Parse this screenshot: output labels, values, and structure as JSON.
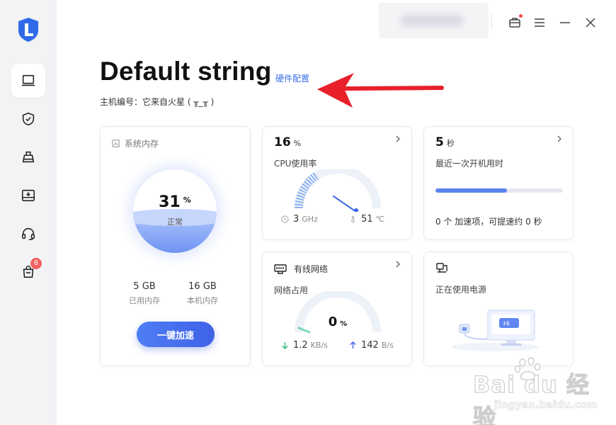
{
  "header": {
    "title": "Default string",
    "hardware_link": "硬件配置",
    "host_id": "主机编号：它来自火星 ( ╥_╥ )"
  },
  "sidebar": {
    "items": [
      {
        "icon": "computer-icon"
      },
      {
        "icon": "shield-check-icon"
      },
      {
        "icon": "broom-icon"
      },
      {
        "icon": "drive-download-icon"
      },
      {
        "icon": "headset-icon"
      },
      {
        "icon": "bag-icon",
        "badge": "6"
      }
    ]
  },
  "memory": {
    "title": "系统内存",
    "percent": "31",
    "percent_unit": "%",
    "status": "正常",
    "used_value": "5 GB",
    "used_label": "已用内存",
    "total_value": "16 GB",
    "total_label": "本机内存",
    "boost_button": "一键加速",
    "fill_fraction": 0.31
  },
  "cpu": {
    "percent": "16",
    "percent_unit": "%",
    "label": "CPU使用率",
    "freq_value": "3",
    "freq_unit": "GHz",
    "temp_value": "51",
    "temp_unit": "℃",
    "gauge_fraction": 0.16
  },
  "boot": {
    "seconds": "5",
    "seconds_unit": "秒",
    "label": "最近一次开机用时",
    "tip": "0 个 加速项，可提速约 0 秒",
    "progress_fraction": 0.56
  },
  "network": {
    "title": "有线网络",
    "label": "网络占用",
    "percent": "0",
    "percent_unit": "%",
    "down_value": "1.2",
    "down_unit": "KB/s",
    "up_value": "142",
    "up_unit": "B/s"
  },
  "power": {
    "label": "正在使用电源",
    "screen_text": "Hi"
  },
  "watermark": {
    "brand": "Bai du 经验",
    "url": "jingyan.baidu.com"
  },
  "colors": {
    "accent": "#3f66e8",
    "sidebar_bg": "#f2f3f5",
    "annotation": "#e8202a",
    "badge": "#f06060"
  }
}
